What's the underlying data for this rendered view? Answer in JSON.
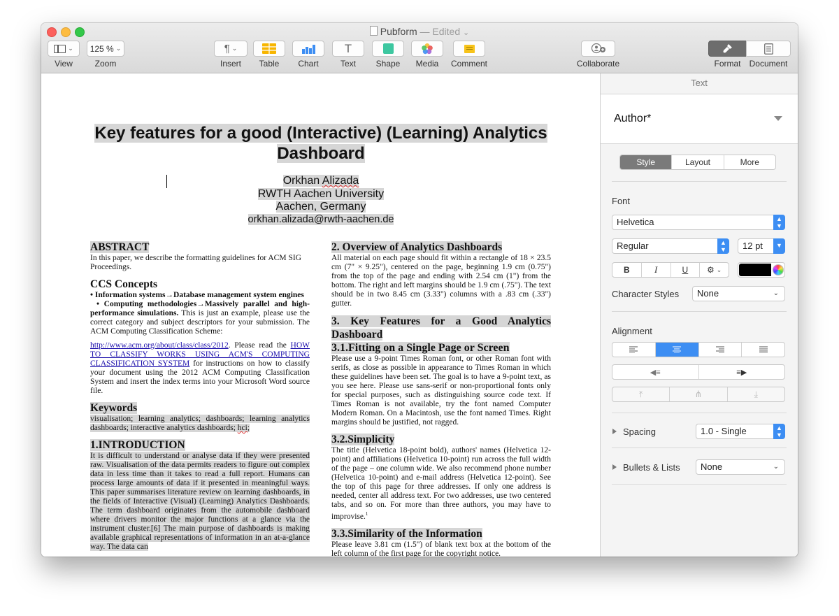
{
  "window": {
    "title": "Pubform",
    "status": "— Edited",
    "title_chevron": "⌄"
  },
  "toolbar": {
    "view": {
      "label": "View",
      "icon": "sidebar-view-icon"
    },
    "zoom": {
      "label": "Zoom",
      "value": "125 %"
    },
    "insert": {
      "label": "Insert",
      "icon": "paragraph-icon",
      "glyph": "¶"
    },
    "table": {
      "label": "Table",
      "icon": "table-icon"
    },
    "chart": {
      "label": "Chart",
      "icon": "chart-icon"
    },
    "text": {
      "label": "Text",
      "icon": "text-icon",
      "glyph": "T"
    },
    "shape": {
      "label": "Shape",
      "icon": "shape-icon"
    },
    "media": {
      "label": "Media",
      "icon": "media-icon"
    },
    "comment": {
      "label": "Comment",
      "icon": "comment-icon"
    },
    "collaborate": {
      "label": "Collaborate",
      "icon": "collaborate-icon"
    },
    "format": {
      "label": "Format",
      "icon": "paintbrush-icon"
    },
    "document": {
      "label": "Document",
      "icon": "document-icon"
    }
  },
  "document": {
    "title_line1": "Key features for a good (Interactive) (Learning) Analytics",
    "title_line2": "Dashboard",
    "author_name_first": "Orkhan ",
    "author_name_last": "Alizada",
    "affiliation": "RWTH Aachen University",
    "location": "Aachen, Germany",
    "email": "orkhan.alizada@rwth-aachen.de",
    "left": {
      "abstract_h": "ABSTRACT",
      "abstract_p": "In this paper, we describe the formatting guidelines for ACM SIG Proceedings.",
      "ccs_h": "CCS Concepts",
      "ccs_1": "• Information systems→Database management system engines",
      "ccs_2": "• Computing methodologies→Massively parallel and high-performance simulations.",
      "ccs_3": " This is just an example, please use the correct category and subject descriptors for your submission. The ACM Computing Classification Scheme:",
      "ccs_link": "http://www.acm.org/about/class/class/2012",
      "ccs_4": ". Please read the ",
      "ccs_link2": "HOW TO CLASSIFY WORKS USING ACM'S COMPUTING CLASSIFICATION SYSTEM",
      "ccs_5": " for instructions on how to classify your document using the 2012 ACM Computing Classification System and insert the index terms into your Microsoft Word source file.",
      "kw_h": "Keywords",
      "kw_p": "visualisation; learning analytics; dashboards; learning analytics dashboards; interactive analytics dashboards; ",
      "kw_last": "hci",
      "kw_end": ";",
      "intro_h": "1.INTRODUCTION",
      "intro_p": "It is difficult to understand or analyse data if they were presented raw. Visualisation of the data permits readers to figure out complex data in less time than it takes to read a full report. Humans can process large amounts of data if it presented in meaningful ways. This paper summarises literature review on learning dashboards, in the fields of Interactive (Visual) (Learning) Analytics Dashboards. The term dashboard originates from the automobile dashboard where drivers monitor the major functions at a glance via the instrument cluster.[6] The main purpose of dashboards is making available graphical representations of information in an at-a-glance way. The data can"
    },
    "right": {
      "s2_h": "2. Overview of Analytics Dashboards",
      "s2_p": "All material on each page should fit within a rectangle of 18 × 23.5 cm (7\" × 9.25\"), centered on the page, beginning 1.9 cm (0.75\") from the top of the page and ending with 2.54 cm (1\") from the bottom. The right and left margins should be 1.9 cm (.75\"). The text should be in two 8.45 cm (3.33\") columns with a .83 cm (.33\") gutter.",
      "s3_h": "3. Key Features for a Good Analytics Dashboard",
      "s31_h": "3.1.Fitting on a Single Page or Screen",
      "s31_p": "Please use a 9-point Times Roman font, or other Roman font with serifs, as close as possible in appearance to Times Roman in which these guidelines have been set. The goal is to have a 9-point text, as you see here. Please use sans-serif or non-proportional fonts only for special purposes, such as distinguishing source code text. If Times Roman is not available, try the font named Computer Modern Roman. On a Macintosh, use the font named Times. Right margins should be justified, not ragged.",
      "s32_h": "3.2.Simplicity",
      "s32_p": "The title (Helvetica 18-point bold), authors' names (Helvetica 12-point) and affiliations (Helvetica 10-point) run across the full width of the page – one column wide. We also recommend phone number (Helvetica 10-point) and e-mail address (Helvetica 12-point). See the top of this page for three addresses. If only one address is needed, center all address text. For two addresses, use two centered tabs, and so on. For more than three authors, you may have to improvise.",
      "s32_sup": "1",
      "s33_h": "3.3.Similarity of the Information",
      "s33_p": "Please leave 3.81 cm (1.5\") of blank text box at the bottom of the left column of the first page for the copyright notice."
    }
  },
  "sidebar": {
    "header": "Text",
    "paragraph_style": "Author*",
    "tabs": [
      "Style",
      "Layout",
      "More"
    ],
    "font_label": "Font",
    "font_family": "Helvetica",
    "font_style": "Regular",
    "font_size": "12 pt",
    "bold": "B",
    "italic": "I",
    "underline": "U",
    "gear": "⚙",
    "char_styles_label": "Character Styles",
    "char_styles_value": "None",
    "alignment_label": "Alignment",
    "spacing_label": "Spacing",
    "spacing_value": "1.0 - Single",
    "bullets_label": "Bullets & Lists",
    "bullets_value": "None",
    "text_color": "#000000",
    "accent": "#3d8ef3"
  }
}
